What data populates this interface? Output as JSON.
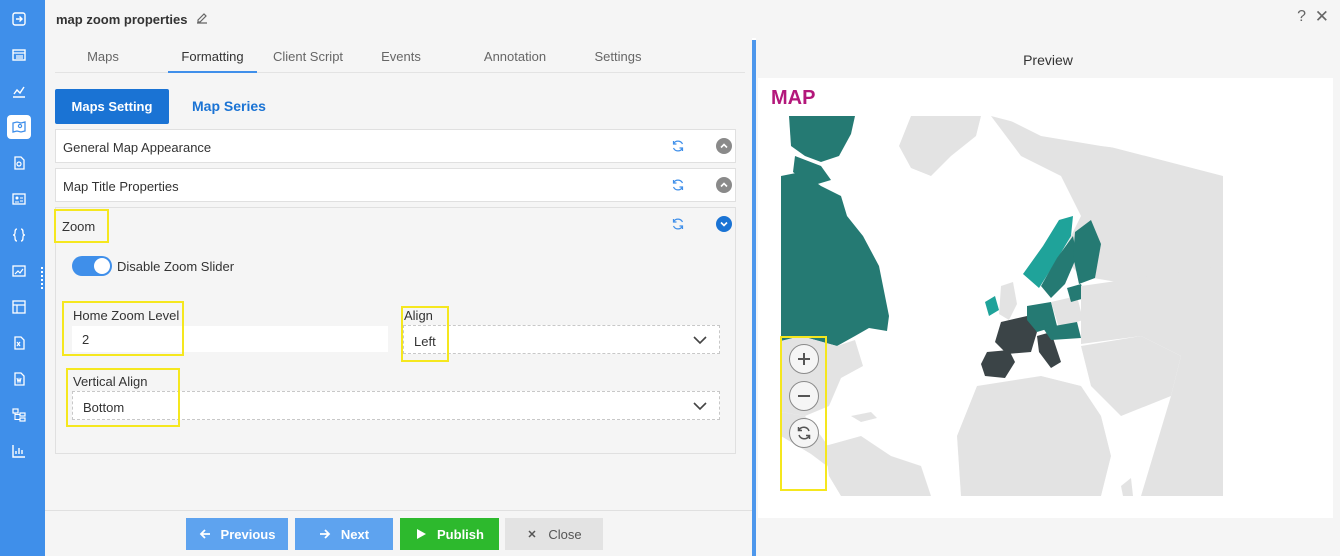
{
  "header": {
    "title": "map zoom properties",
    "help": "?",
    "close": "✕"
  },
  "tabs": [
    "Maps",
    "Formatting",
    "Client Script",
    "Events",
    "Annotation",
    "Settings"
  ],
  "active_tab": "Formatting",
  "subtabs": {
    "primary": "Maps Setting",
    "secondary": "Map Series"
  },
  "accordions": {
    "general": "General Map Appearance",
    "title": "Map Title Properties",
    "zoom": "Zoom"
  },
  "zoom": {
    "disable_slider_label": "Disable Zoom Slider",
    "disable_slider_on": true,
    "home_zoom_label": "Home Zoom Level",
    "home_zoom_value": "2",
    "align_label": "Align",
    "align_value": "Left",
    "vertical_align_label": "Vertical Align",
    "vertical_align_value": "Bottom"
  },
  "footer": {
    "previous": "Previous",
    "next": "Next",
    "publish": "Publish",
    "close": "Close"
  },
  "preview": {
    "title": "Preview",
    "map_title": "MAP"
  },
  "colors": {
    "accent": "#3f8fea",
    "primary": "#1a73d4",
    "publish": "#2db92d",
    "map_title": "#b3177a",
    "teal": "#257a73",
    "teal_light": "#1fa39a",
    "dark": "#3b4447",
    "land": "#e3e3e3"
  }
}
